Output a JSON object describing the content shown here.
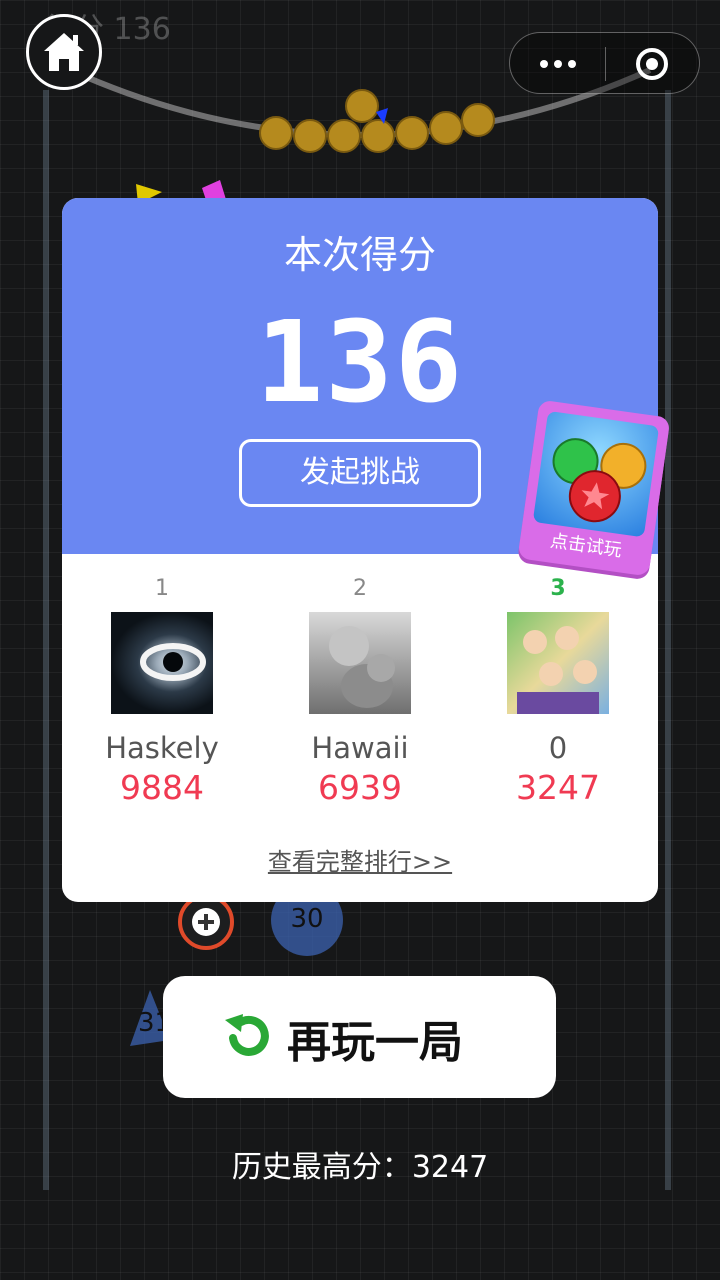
{
  "background": {
    "faded_score": "得分 136",
    "ball_badge_1": "30",
    "ball_badge_2": "31"
  },
  "nav": {
    "home_icon": "home-icon",
    "more_icon": "more-dots-icon",
    "close_icon": "miniprogram-close-icon"
  },
  "result_card": {
    "score_label": "本次得分",
    "score_value": "136",
    "challenge_label": "发起挑战",
    "full_ranking_link": "查看完整排行>>",
    "ranking": [
      {
        "rank": "1",
        "name": "Haskely",
        "score": "9884"
      },
      {
        "rank": "2",
        "name": "Hawaii",
        "score": "6939"
      },
      {
        "rank": "3",
        "name": "0",
        "score": "3247"
      }
    ]
  },
  "promo": {
    "label": "点击试玩"
  },
  "replay": {
    "label": "再玩一局",
    "icon": "replay-icon"
  },
  "history": {
    "label": "历史最高分：",
    "value": "3247"
  },
  "colors": {
    "card_blue": "#6a87f2",
    "score_red": "#f03a52",
    "rank3_green": "#2bb24c",
    "replay_green": "#2aa836"
  }
}
